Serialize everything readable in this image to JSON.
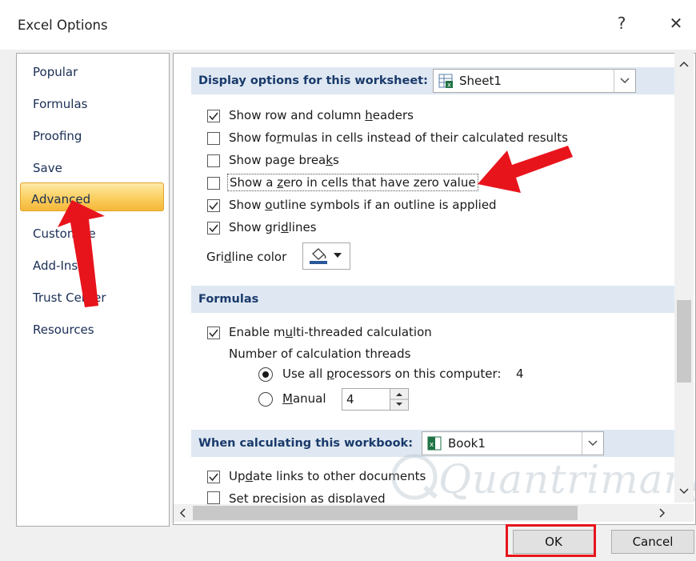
{
  "window": {
    "title": "Excel Options",
    "help_label": "?",
    "close_label": "✕"
  },
  "sidebar": {
    "items": [
      {
        "label": "Popular"
      },
      {
        "label": "Formulas"
      },
      {
        "label": "Proofing"
      },
      {
        "label": "Save"
      },
      {
        "label": "Advanced",
        "selected": true
      },
      {
        "label": "Customize"
      },
      {
        "label": "Add-Ins"
      },
      {
        "label": "Trust Center"
      },
      {
        "label": "Resources"
      }
    ]
  },
  "worksheet_section": {
    "label": "Display options for this worksheet:",
    "selected_sheet": "Sheet1",
    "options": [
      {
        "label": "Show row and column headers",
        "checked": true
      },
      {
        "label": "Show formulas in cells instead of their calculated results",
        "checked": false
      },
      {
        "label": "Show page breaks",
        "checked": false
      },
      {
        "label": "Show a zero in cells that have zero value",
        "checked": false
      },
      {
        "label": "Show outline symbols if an outline is applied",
        "checked": true
      },
      {
        "label": "Show gridlines",
        "checked": true
      }
    ],
    "gridline_color_label": "Gridline color"
  },
  "formulas_section": {
    "label": "Formulas",
    "multithread_label": "Enable multi-threaded calculation",
    "multithread_checked": true,
    "threads_label": "Number of calculation threads",
    "use_all_label": "Use all processors on this computer:",
    "processor_count": "4",
    "manual_label": "Manual",
    "manual_value": "4"
  },
  "workbook_section": {
    "label": "When calculating this workbook:",
    "selected_book": "Book1",
    "options": [
      {
        "label": "Update links to other documents",
        "checked": true
      },
      {
        "label": "Set precision as displayed",
        "checked": false
      }
    ]
  },
  "buttons": {
    "ok": "OK",
    "cancel": "Cancel"
  },
  "watermark": "Quantrimang",
  "colors": {
    "annotation_red": "#e8141c",
    "selected_gradient": "#fbcf5e",
    "section_bg": "#dfe8f2"
  }
}
